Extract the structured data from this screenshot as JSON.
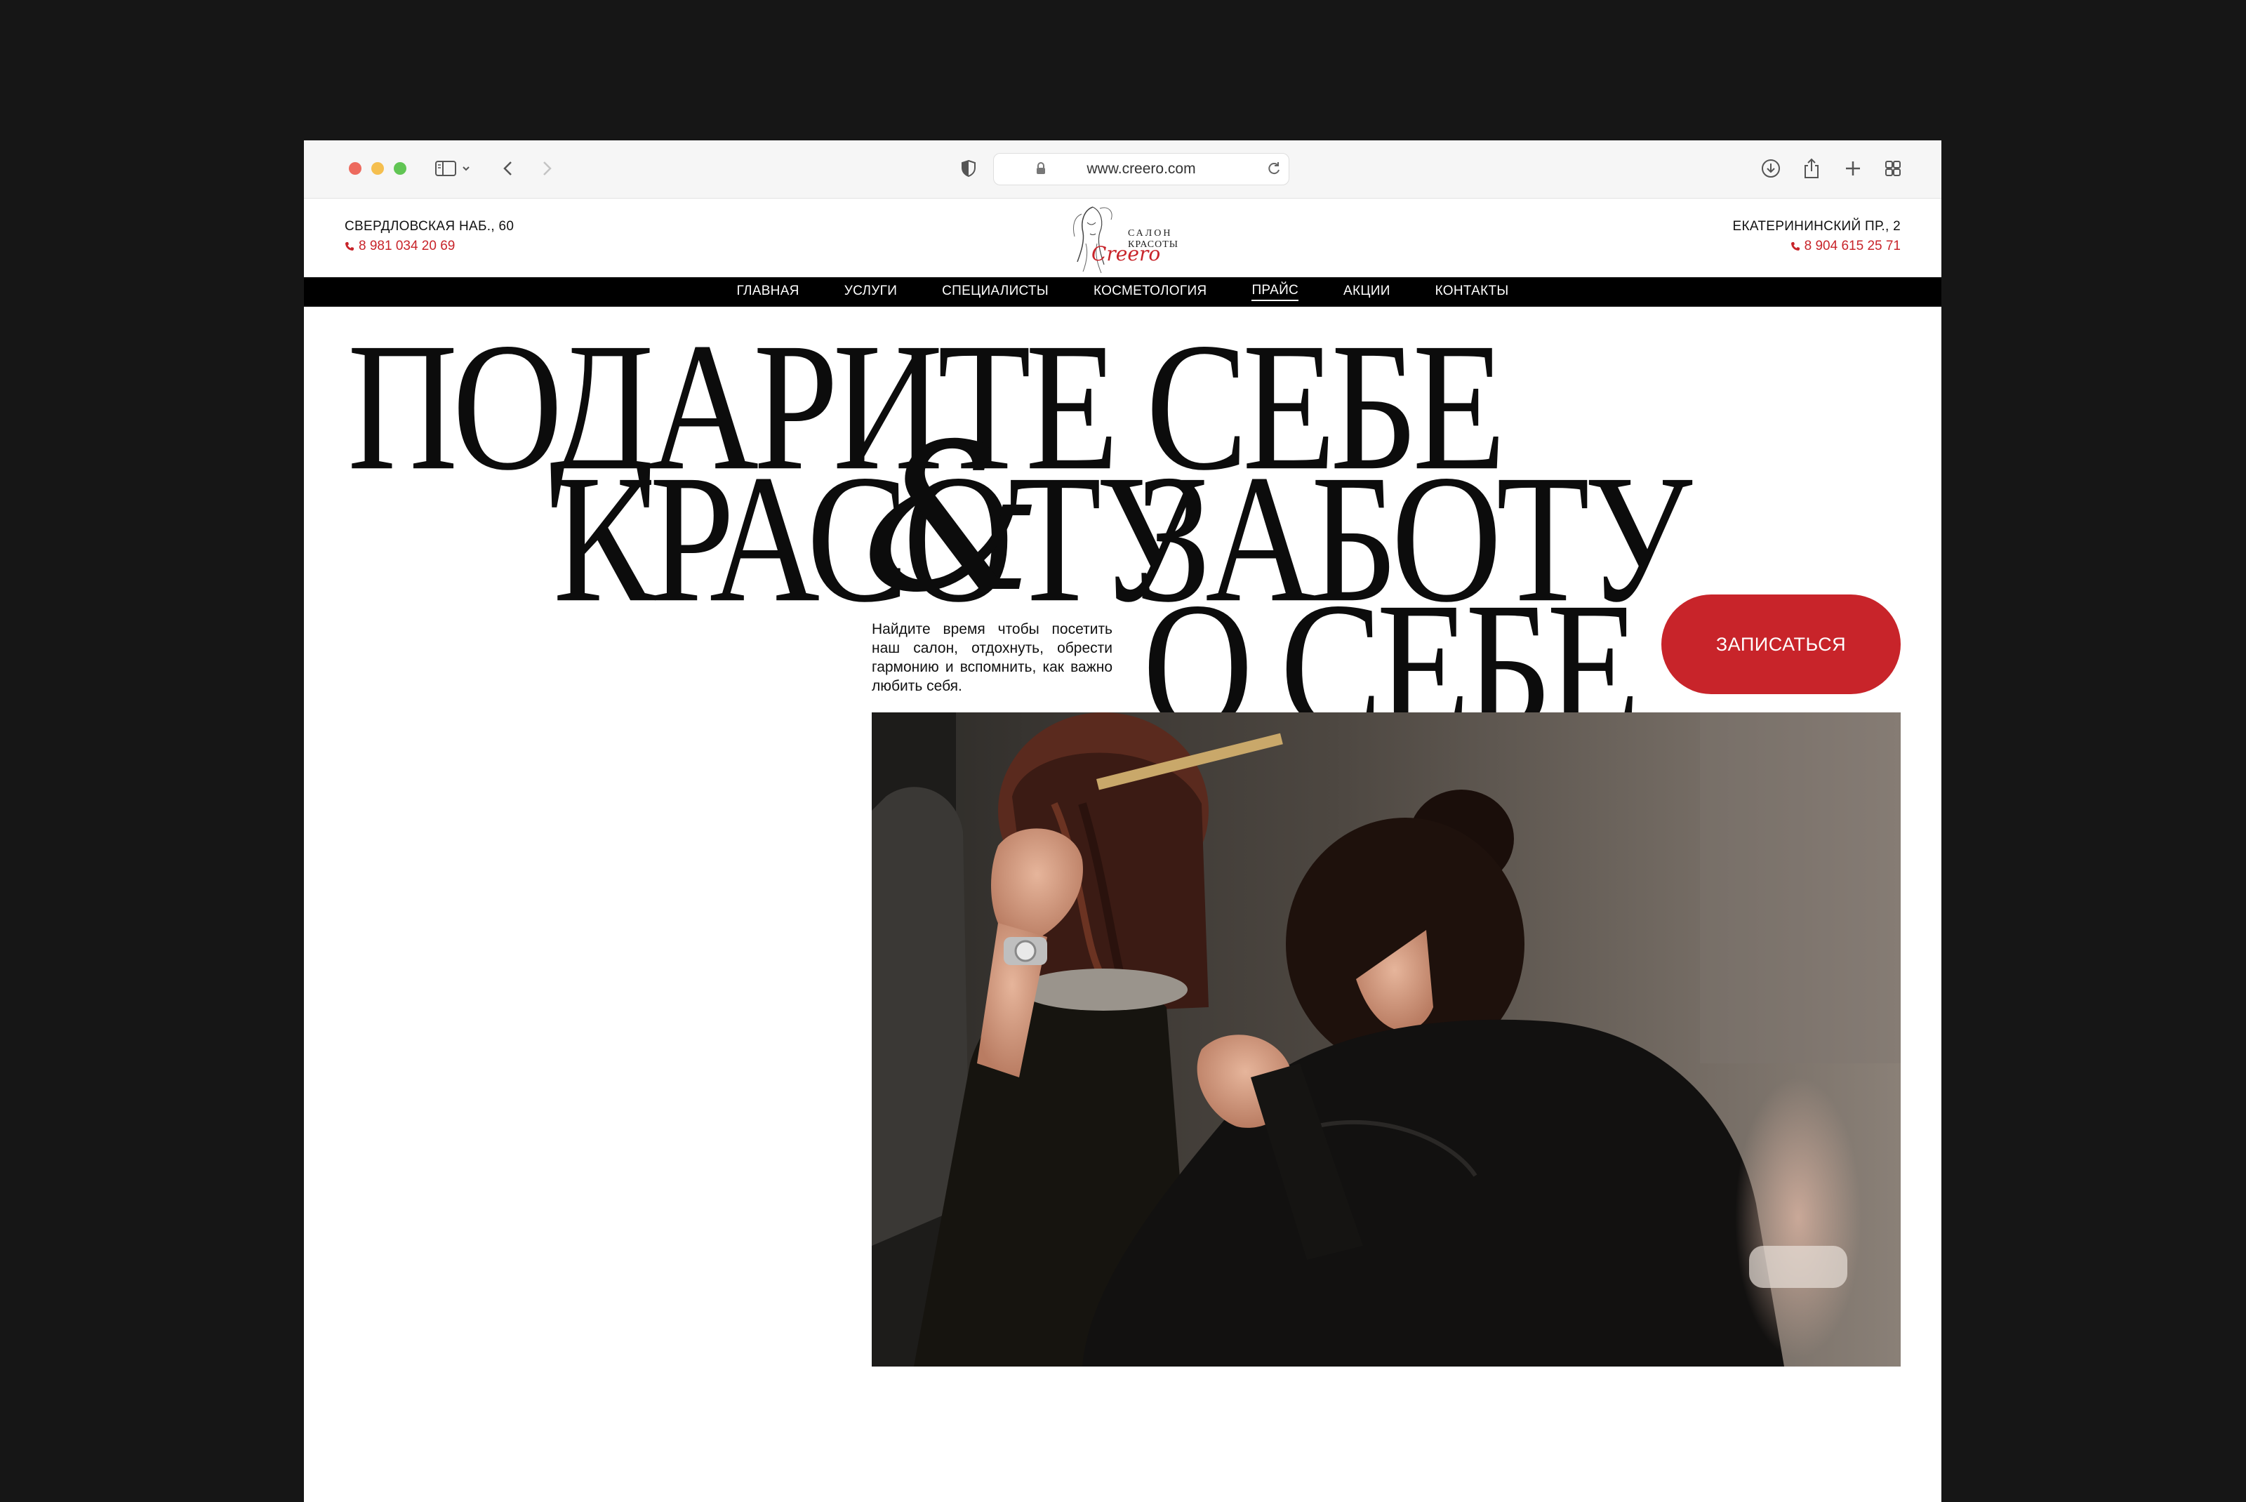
{
  "browser": {
    "url": "www.creero.com"
  },
  "header": {
    "left": {
      "address": "СВЕРДЛОВСКАЯ НАБ., 60",
      "phone": "8 981 034 20 69"
    },
    "right": {
      "address": "ЕКАТЕРИНИНСКИЙ ПР., 2",
      "phone": "8 904 615 25 71"
    },
    "logo": {
      "line1": "САЛОН",
      "line2": "КРАСОТЫ",
      "name": "Creero"
    }
  },
  "nav": {
    "items": [
      "ГЛАВНАЯ",
      "УСЛУГИ",
      "СПЕЦИАЛИСТЫ",
      "КОСМЕТОЛОГИЯ",
      "ПРАЙС",
      "АКЦИИ",
      "КОНТАКТЫ"
    ],
    "active": "ПРАЙС"
  },
  "hero": {
    "line1": "ПОДАРИТЕ СЕБЕ",
    "line2a": "КРАСОТУ",
    "ampersand": "&",
    "line2b": "ЗАБОТУ",
    "line3": "О СЕБЕ",
    "lead": "Найдите время чтобы посетить наш салон, отдохнуть, обрести гармонию и вспомнить, как важно любить себя.",
    "cta": "ЗАПИСАТЬСЯ"
  },
  "colors": {
    "accent": "#c8242a",
    "nav_bg": "#000000",
    "page_bg": "#161616"
  }
}
